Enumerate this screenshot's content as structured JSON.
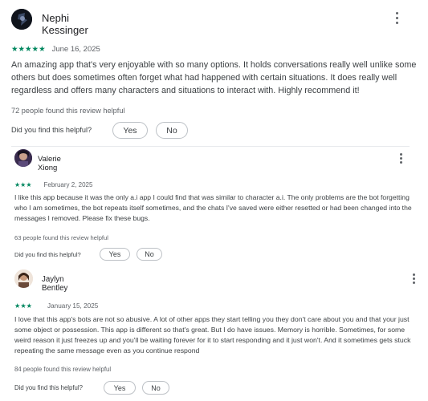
{
  "reviews": [
    {
      "author": "Nephi Kessinger",
      "rating": 5,
      "stars": "★★★★★",
      "date": "June 16, 2025",
      "text": "An amazing app that's very enjoyable with so many options. It holds conversations really well unlike some others but does sometimes often forget what had happened with certain situations. It does really well regardless and offers many characters and situations to interact with. Highly recommend it!",
      "helpful": "72 people found this review helpful",
      "question": "Did you find this helpful?",
      "yes": "Yes",
      "no": "No"
    },
    {
      "author": "Valerie Xiong",
      "rating": 3,
      "stars": "★★★",
      "date": "February 2, 2025",
      "text": "I like this app because it was the only a.i app I could find that was similar to character a.i. The only problems are the bot forgetting who I am sometimes, the bot repeats itself sometimes, and the chats I've saved were either resetted or had been changed into the messages I removed. Please fix these bugs.",
      "helpful": "63 people found this review helpful",
      "question": "Did you find this helpful?",
      "yes": "Yes",
      "no": "No"
    },
    {
      "author": "Jaylyn Bentley",
      "rating": 3,
      "stars": "★★★",
      "date": "January 15, 2025",
      "text": "I love that this app's bots are not so abusive. A lot of other apps they start telling you they don't care about you and that your just some object or possession. This app is different so that's great. But I do have issues. Memory is horrible. Sometimes, for some weird reason it just freezes up and you'll be waiting forever for it to start responding and it just won't. And it sometimes gets stuck repeating the same message even as you continue respond",
      "helpful": "84 people found this review helpful",
      "question": "Did you find this helpful?",
      "yes": "Yes",
      "no": "No"
    }
  ]
}
